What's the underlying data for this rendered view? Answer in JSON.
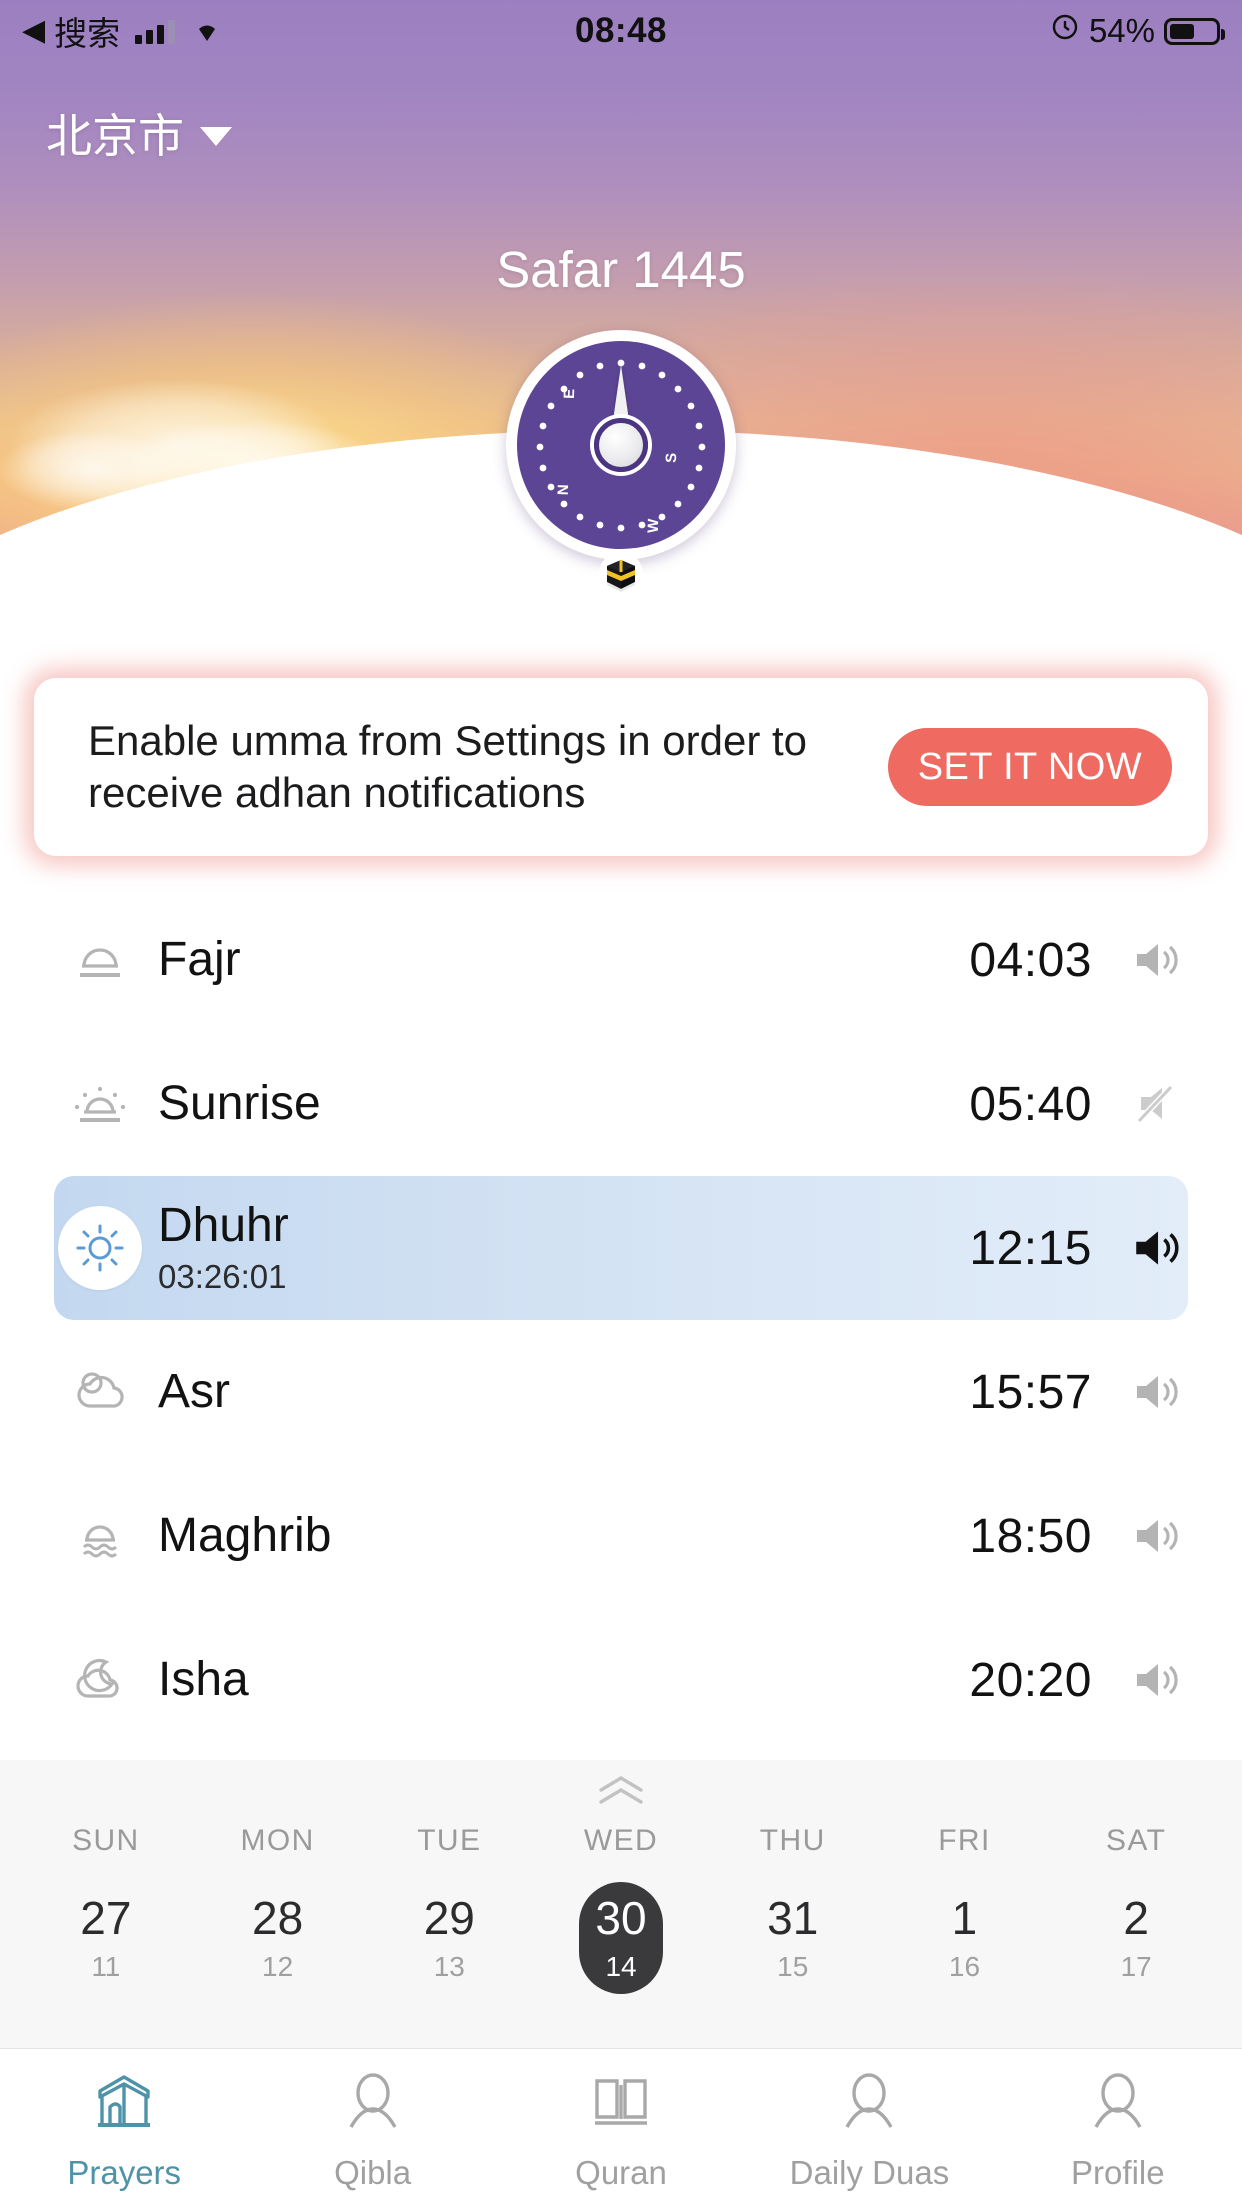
{
  "status_bar": {
    "back_arrow": "◀",
    "carrier_label": "搜索",
    "signal_icon": "signal-bars-icon",
    "wifi_icon": "wifi-icon",
    "time": "08:48",
    "orientation_lock_icon": "rotation-lock-icon",
    "battery_percent": "54%",
    "battery_icon": "battery-icon"
  },
  "header": {
    "city": "北京市",
    "city_caret_icon": "chevron-down-icon",
    "month_title": "Safar 1445",
    "compass_icon": "qibla-compass",
    "kaaba_icon": "kaaba-icon",
    "compass_marks": [
      "N",
      "E",
      "S",
      "W"
    ]
  },
  "banner": {
    "message": "Enable umma from Settings in order to receive adhan notifications",
    "button_label": "SET IT NOW",
    "accent_color": "#ef6b61"
  },
  "prayers": {
    "rows": [
      {
        "name": "Fajr",
        "time": "04:03",
        "icon": "fajr-dawn-icon",
        "sound": "speaker-on-icon",
        "countdown": "",
        "active": false
      },
      {
        "name": "Sunrise",
        "time": "05:40",
        "icon": "sunrise-icon",
        "sound": "speaker-off-icon",
        "countdown": "",
        "active": false
      },
      {
        "name": "Dhuhr",
        "time": "12:15",
        "icon": "sun-icon",
        "sound": "speaker-on-icon",
        "countdown": "03:26:01",
        "active": true
      },
      {
        "name": "Asr",
        "time": "15:57",
        "icon": "sun-behind-cloud-icon",
        "sound": "speaker-on-icon",
        "countdown": "",
        "active": false
      },
      {
        "name": "Maghrib",
        "time": "18:50",
        "icon": "sunset-water-icon",
        "sound": "speaker-on-icon",
        "countdown": "",
        "active": false
      },
      {
        "name": "Isha",
        "time": "20:20",
        "icon": "moon-cloud-icon",
        "sound": "speaker-on-icon",
        "countdown": "",
        "active": false
      }
    ]
  },
  "calendar": {
    "expand_handle_icon": "chevron-double-up-icon",
    "days": [
      {
        "dow": "SUN",
        "num": "27",
        "hijri": "11",
        "selected": false
      },
      {
        "dow": "MON",
        "num": "28",
        "hijri": "12",
        "selected": false
      },
      {
        "dow": "TUE",
        "num": "29",
        "hijri": "13",
        "selected": false
      },
      {
        "dow": "WED",
        "num": "30",
        "hijri": "14",
        "selected": true
      },
      {
        "dow": "THU",
        "num": "31",
        "hijri": "15",
        "selected": false
      },
      {
        "dow": "FRI",
        "num": "1",
        "hijri": "16",
        "selected": false
      },
      {
        "dow": "SAT",
        "num": "2",
        "hijri": "17",
        "selected": false
      }
    ]
  },
  "tabbar": {
    "active_color": "#4e93a8",
    "inactive_color": "#a0a0a0",
    "tabs": [
      {
        "label": "Prayers",
        "icon": "mosque-icon",
        "active": true
      },
      {
        "label": "Qibla",
        "icon": "person-icon",
        "active": false
      },
      {
        "label": "Quran",
        "icon": "book-icon",
        "active": false
      },
      {
        "label": "Daily Duas",
        "icon": "person-icon",
        "active": false
      },
      {
        "label": "Profile",
        "icon": "person-icon",
        "active": false
      }
    ]
  }
}
